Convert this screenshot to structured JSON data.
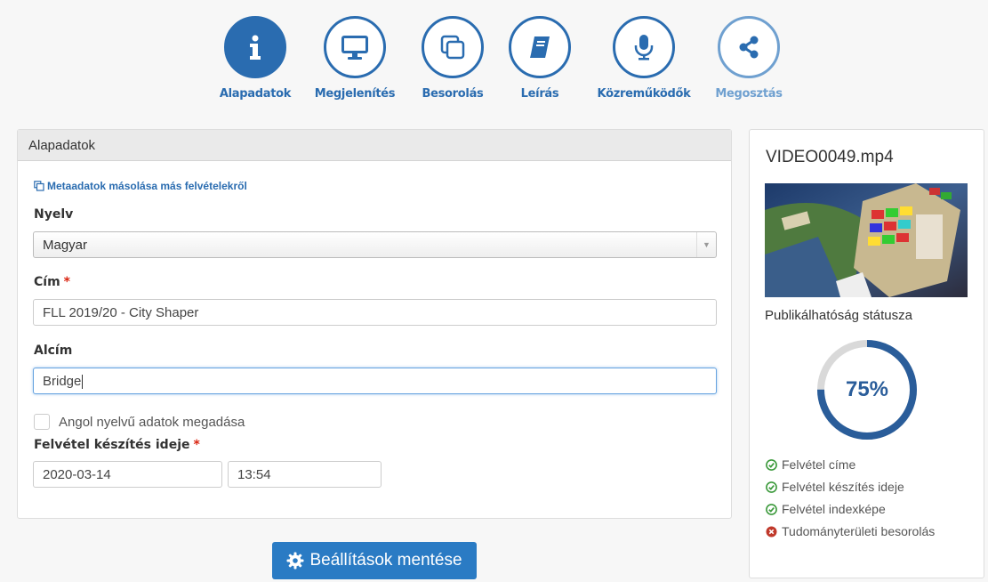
{
  "steps": [
    {
      "label": "Alapadatok",
      "icon": "info-icon",
      "state": "active"
    },
    {
      "label": "Megjelenítés",
      "icon": "monitor-icon",
      "state": "normal"
    },
    {
      "label": "Besorolás",
      "icon": "copy-icon",
      "state": "normal"
    },
    {
      "label": "Leírás",
      "icon": "book-icon",
      "state": "normal"
    },
    {
      "label": "Közreműködők",
      "icon": "microphone-icon",
      "state": "normal"
    },
    {
      "label": "Megosztás",
      "icon": "share-icon",
      "state": "muted"
    }
  ],
  "panel": {
    "title": "Alapadatok",
    "copy_link": "Metaadatok másolása más felvételekről",
    "language_label": "Nyelv",
    "language_value": "Magyar",
    "title_label": "Cím",
    "title_value": "FLL 2019/20 - City Shaper",
    "subtitle_label": "Alcím",
    "subtitle_value": "Bridge",
    "english_checkbox_label": "Angol nyelvű adatok megadása",
    "english_checked": false,
    "recorded_label": "Felvétel készítés ideje",
    "required_mark": "*",
    "date_value": "2020-03-14",
    "time_value": "13:54"
  },
  "save_button": "Beállítások mentése",
  "side": {
    "filename": "VIDEO0049.mp4",
    "status_label": "Publikálhatóság státusza",
    "progress_percent": 75,
    "progress_text": "75%",
    "checklist": [
      {
        "label": "Felvétel címe",
        "status": "ok"
      },
      {
        "label": "Felvétel készítés ideje",
        "status": "ok"
      },
      {
        "label": "Felvétel indexképe",
        "status": "ok"
      },
      {
        "label": "Tudományterületi besorolás",
        "status": "error"
      }
    ]
  },
  "colors": {
    "primary": "#2a6cb0",
    "ok": "#3c9a3c",
    "error": "#c0392b",
    "ring_track": "#d9d9d9",
    "ring_fill": "#2a5d9a"
  }
}
